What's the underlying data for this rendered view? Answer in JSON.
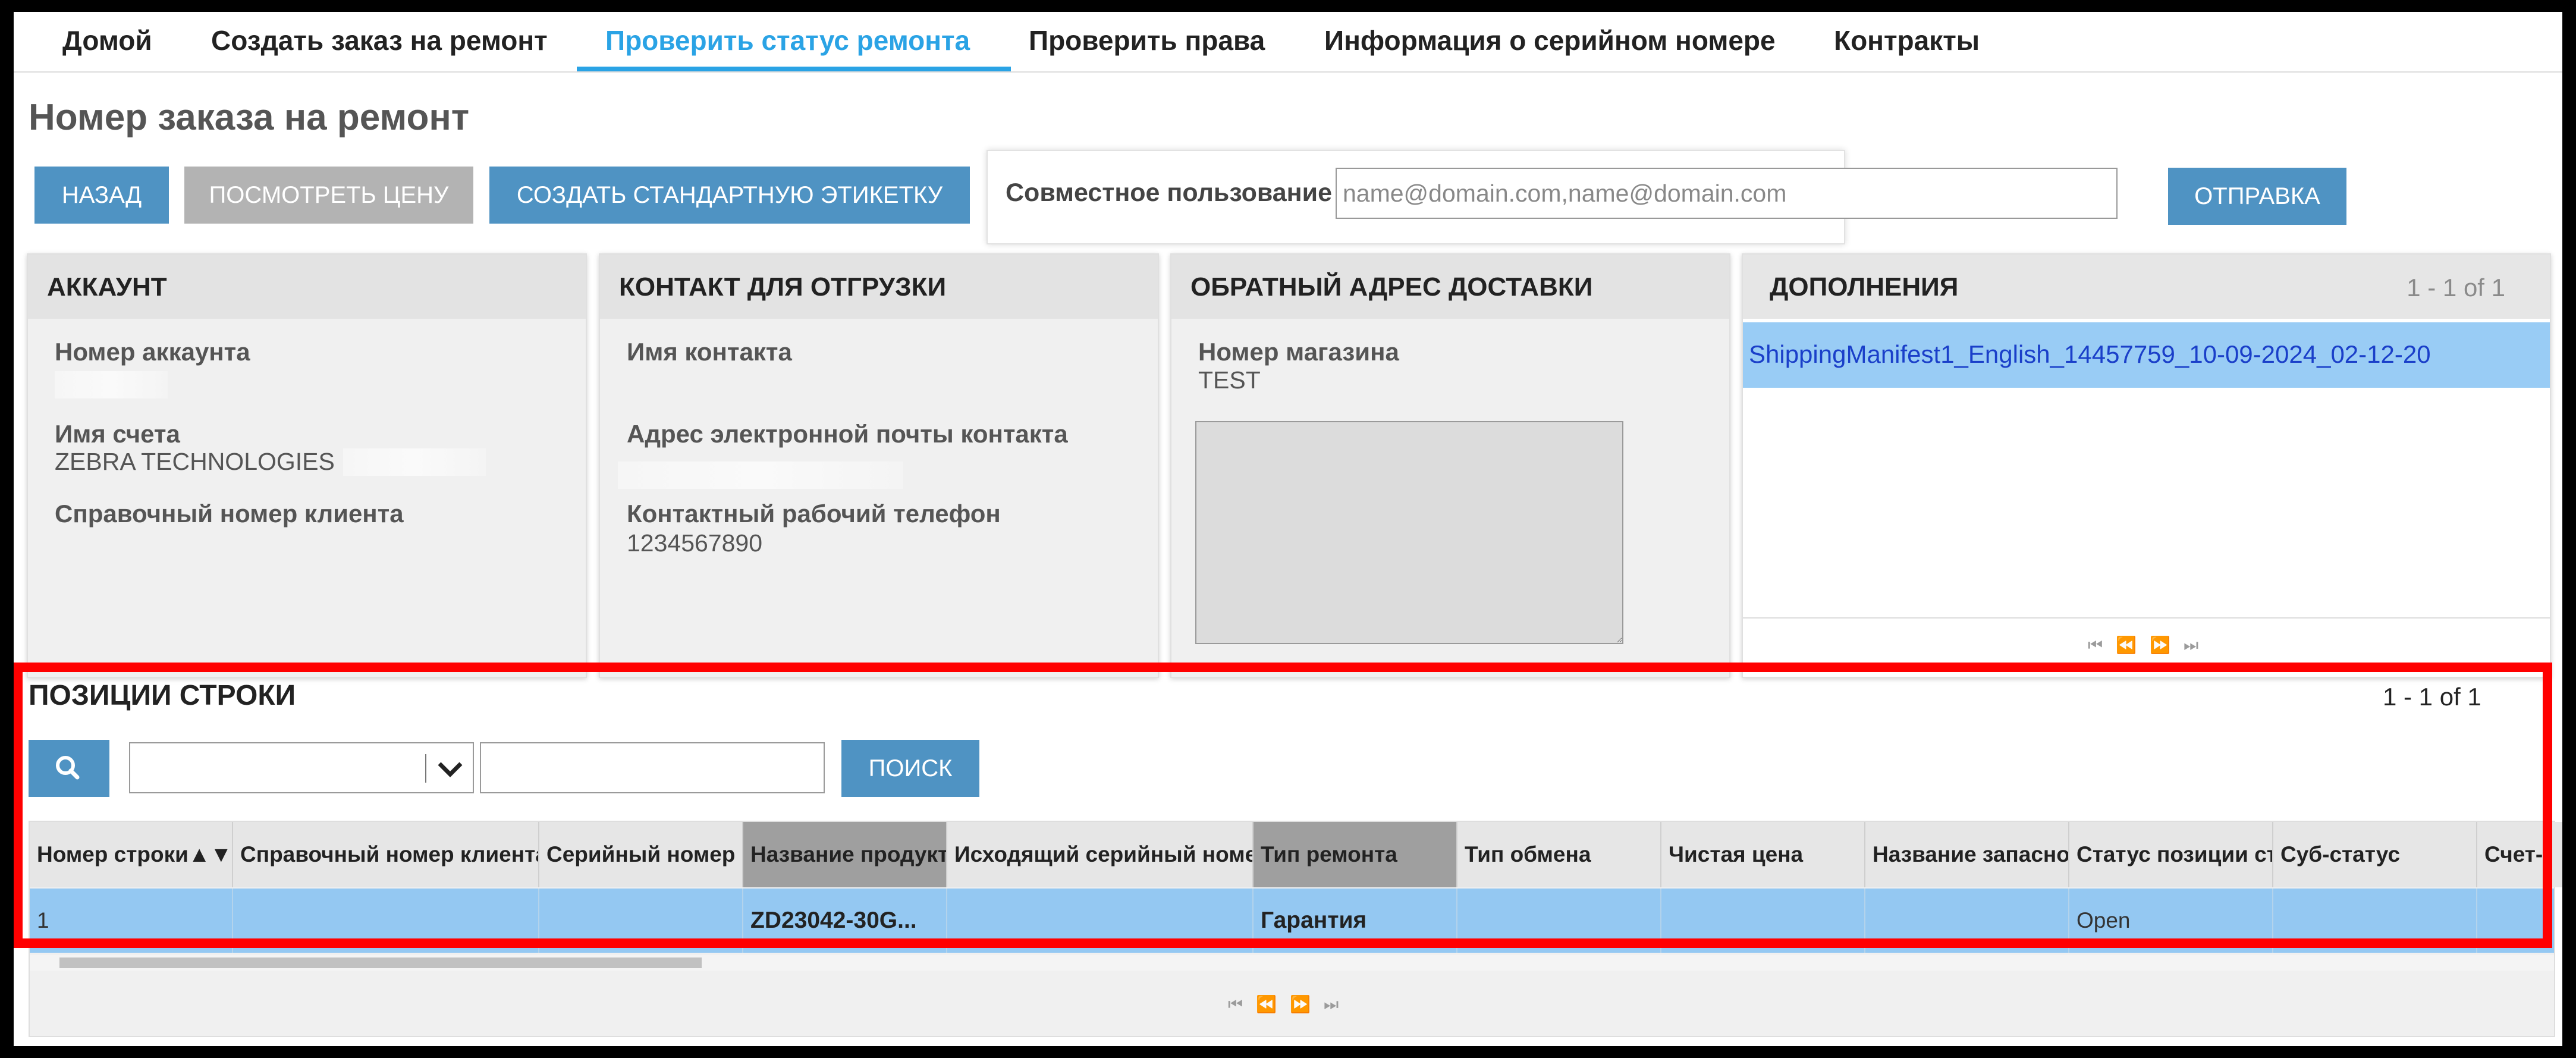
{
  "nav": {
    "items": [
      {
        "label": "Домой"
      },
      {
        "label": "Создать заказ на ремонт"
      },
      {
        "label": "Проверить статус ремонта"
      },
      {
        "label": "Проверить права"
      },
      {
        "label": "Информация о серийном номере"
      },
      {
        "label": "Контракты"
      }
    ],
    "active_index": 2,
    "accent_color": "#2aa3e5"
  },
  "page_title": "Номер заказа на ремонт",
  "toolbar": {
    "back_label": "НАЗАД",
    "view_price_label": "ПОСМОТРЕТЬ ЦЕНУ",
    "create_label_label": "СОЗДАТЬ СТАНДАРТНУЮ ЭТИКЕТКУ"
  },
  "share": {
    "label": "Совместное пользование",
    "placeholder": "name@domain.com,name@domain.com",
    "send_label": "ОТПРАВКА"
  },
  "account": {
    "title": "АККАУНТ",
    "account_number_label": "Номер аккаунта",
    "account_name_label": "Имя счета",
    "account_name_value": "ZEBRA TECHNOLOGIES",
    "customer_ref_label": "Справочный номер клиента"
  },
  "shipping_contact": {
    "title": "КОНТАКТ ДЛЯ ОТГРУЗКИ",
    "contact_name_label": "Имя контакта",
    "email_label": "Адрес электронной почты контакта",
    "phone_label": "Контактный рабочий телефон",
    "phone_value": "1234567890"
  },
  "return_address": {
    "title": "ОБРАТНЫЙ АДРЕС ДОСТАВКИ",
    "store_number_label": "Номер магазина",
    "store_number_value": "TEST"
  },
  "attachments": {
    "title": "ДОПОЛНЕНИЯ",
    "count": "1 - 1 of 1",
    "files": [
      "ShippingManifest1_English_14457759_10-09-2024_02-12-20"
    ]
  },
  "line_items": {
    "title": "ПОЗИЦИИ СТРОКИ",
    "count": "1 - 1 of 1",
    "search_label": "ПОИСК",
    "columns": [
      "Номер строки▲▼",
      "Справочный номер клиента",
      "Серийный номер",
      "Название продукта",
      "Исходящий серийный номер",
      "Тип ремонта",
      "Тип обмена",
      "Чистая цена",
      "Название запасной",
      "Статус позиции строки",
      "Суб-статус",
      "Счет-"
    ],
    "rows": [
      [
        "1",
        "",
        "",
        "ZD23042-30G...",
        "",
        "Гарантия",
        "",
        "",
        "",
        "Open",
        "",
        ""
      ]
    ]
  },
  "highlight_color": "#ff0000"
}
